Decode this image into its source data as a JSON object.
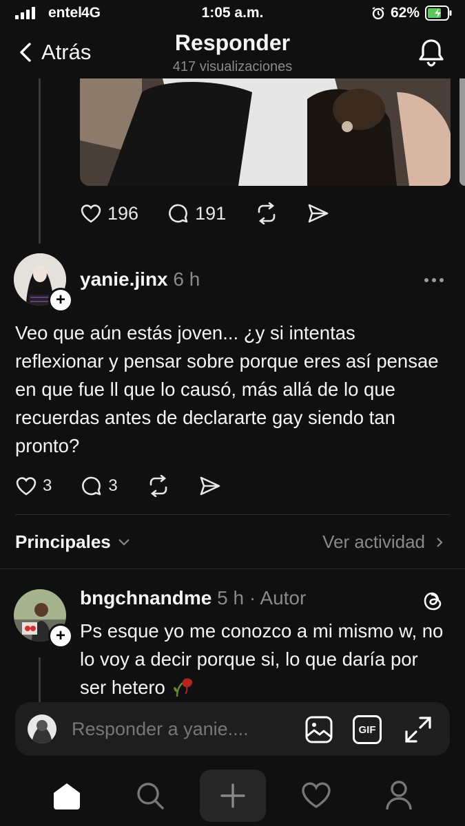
{
  "status_bar": {
    "carrier": "entel",
    "network": "4G",
    "time": "1:05 a.m.",
    "battery": "62%"
  },
  "header": {
    "back_label": "Atrás",
    "title": "Responder",
    "views": "417 visualizaciones"
  },
  "original_post": {
    "likes": "196",
    "replies": "191"
  },
  "comment": {
    "username": "yanie.jinx",
    "time": "6 h",
    "text": "Veo que aún estás joven... ¿y si intentas reflexionar y pensar sobre porque eres así pensae en que fue ll que lo causó, más allá de lo que recuerdas antes de declararte gay siendo tan pronto?",
    "likes": "3",
    "replies": "3"
  },
  "sort": {
    "label": "Principales",
    "activity": "Ver actividad"
  },
  "reply": {
    "username": "bngchnandme",
    "time": "5 h",
    "author_tag": "Autor",
    "separator": "·",
    "text": "Ps esque yo me conozco a mi mismo w, no lo voy a decir porque si, lo que daría por ser hetero"
  },
  "composer": {
    "placeholder": "Responder a yanie....",
    "gif_label": "GIF"
  },
  "icons": [
    "heart-icon",
    "comment-icon",
    "repost-icon",
    "share-icon",
    "more-icon",
    "threads-icon",
    "image-icon",
    "gif-icon",
    "expand-icon",
    "home-icon",
    "search-icon",
    "create-icon",
    "activity-icon",
    "profile-icon",
    "bell-icon"
  ]
}
